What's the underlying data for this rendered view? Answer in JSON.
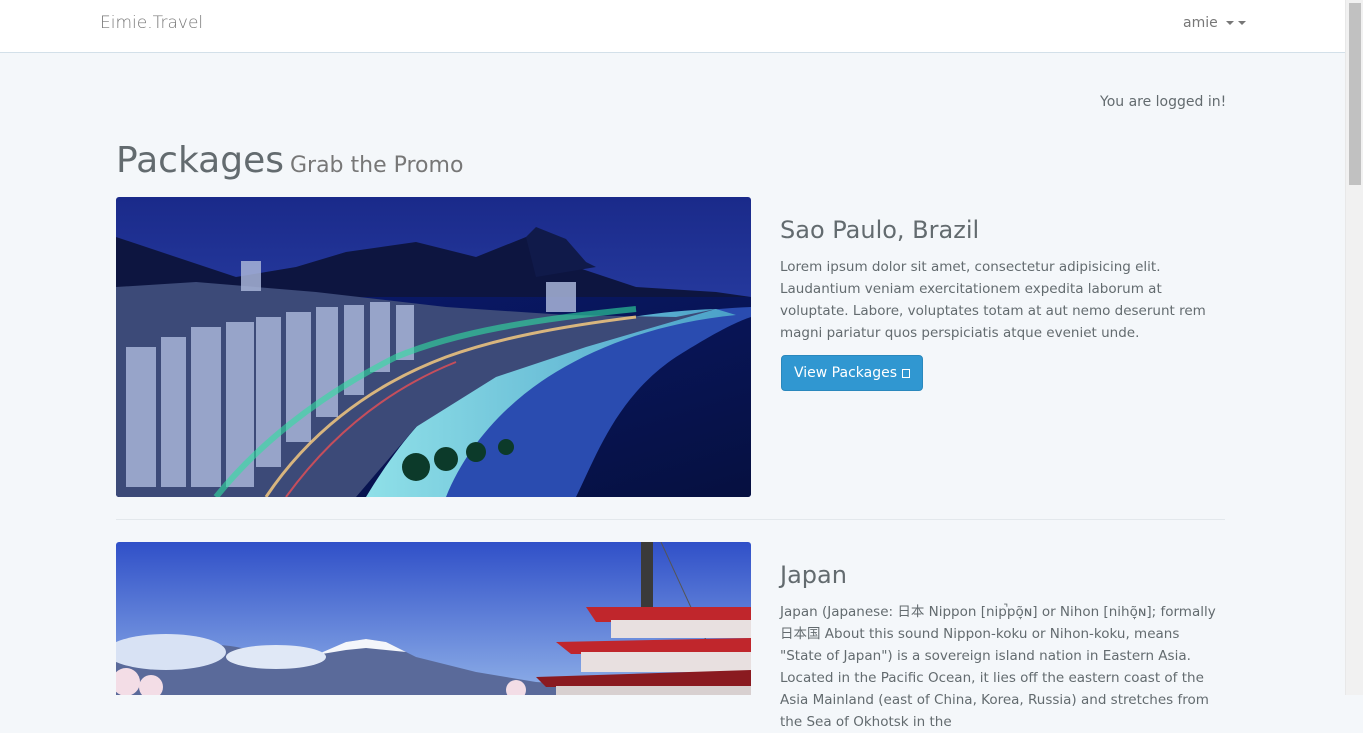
{
  "navbar": {
    "brand": "Eimie.Travel",
    "user": "amie"
  },
  "status_message": "You are logged in!",
  "header": {
    "title": "Packages",
    "subtitle": "Grab the Promo"
  },
  "packages": [
    {
      "title": "Sao Paulo, Brazil",
      "description": "Lorem ipsum dolor sit amet, consectetur adipisicing elit. Laudantium veniam exercitationem expedita laborum at voluptate. Labore, voluptates totam at aut nemo deserunt rem magni pariatur quos perspiciatis atque eveniet unde.",
      "button_label": "View Packages"
    },
    {
      "title": "Japan",
      "description": "Japan (Japanese: 日本 Nippon [nip̚põ̞ɴ] or Nihon [nihõ̞ɴ]; formally 日本国 About this sound Nippon-koku or Nihon-koku, means \"State of Japan\") is a sovereign island nation in Eastern Asia. Located in the Pacific Ocean, it lies off the eastern coast of the Asia Mainland (east of China, Korea, Russia) and stretches from the Sea of Okhotsk in the"
    }
  ],
  "colors": {
    "primary_button": "#3097d1",
    "background": "#f4f7fa",
    "navbar": "#ffffff"
  },
  "icons": {
    "user_menu": "caret-down-icon",
    "button": "arrow-glyph-icon"
  }
}
